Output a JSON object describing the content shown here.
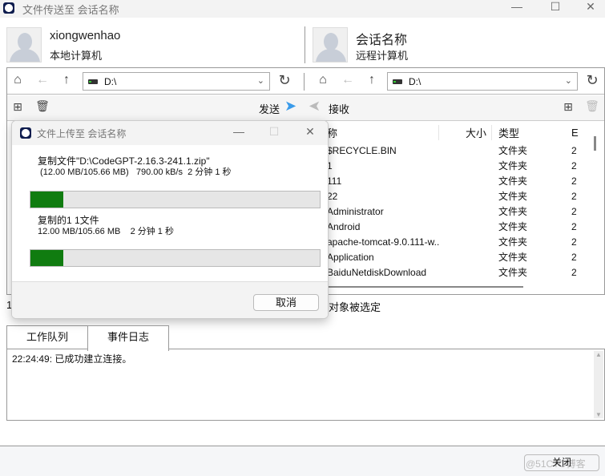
{
  "window": {
    "title": "文件传送至 会话名称"
  },
  "local": {
    "name": "xiongwenhao",
    "label": "本地计算机",
    "path": "D:\\"
  },
  "remote": {
    "name": "会话名称",
    "label": "远程计算机",
    "path": "D:\\"
  },
  "toolbar": {
    "send": "发送",
    "receive": "接收"
  },
  "remote_files": {
    "columns": [
      "称",
      "大小",
      "类型",
      "E"
    ],
    "rows": [
      {
        "name": "$RECYCLE.BIN",
        "type": "文件夹",
        "date": "2"
      },
      {
        "name": "1",
        "type": "文件夹",
        "date": "2"
      },
      {
        "name": "111",
        "type": "文件夹",
        "date": "2"
      },
      {
        "name": "22",
        "type": "文件夹",
        "date": "2"
      },
      {
        "name": "Administrator",
        "type": "文件夹",
        "date": "2"
      },
      {
        "name": "Android",
        "type": "文件夹",
        "date": "2"
      },
      {
        "name": "apache-tomcat-9.0.111-w...",
        "type": "文件夹",
        "date": "2"
      },
      {
        "name": "Application",
        "type": "文件夹",
        "date": "2"
      },
      {
        "name": "BaiduNetdiskDownload",
        "type": "文件夹",
        "date": "2"
      }
    ]
  },
  "status": {
    "left": "1",
    "right": "对象被选定"
  },
  "dialog": {
    "title": "文件上传至 会话名称",
    "file_line": "复制文件\"D:\\CodeGPT-2.16.3-241.1.zip\"",
    "file_detail": " (12.00 MB/105.66 MB)   790.00 kB/s  2 分钟 1 秒",
    "file_progress": 11.4,
    "total_line": "复制的1 1文件",
    "total_detail": "12.00 MB/105.66 MB    2 分钟 1 秒",
    "total_progress": 11.4,
    "cancel": "取消"
  },
  "tabs": [
    {
      "label": "工作队列"
    },
    {
      "label": "事件日志",
      "active": true
    }
  ],
  "log": [
    "22:24:49: 已成功建立连接。"
  ],
  "footer": {
    "close": "关闭",
    "watermark": "@51CTO博客"
  }
}
